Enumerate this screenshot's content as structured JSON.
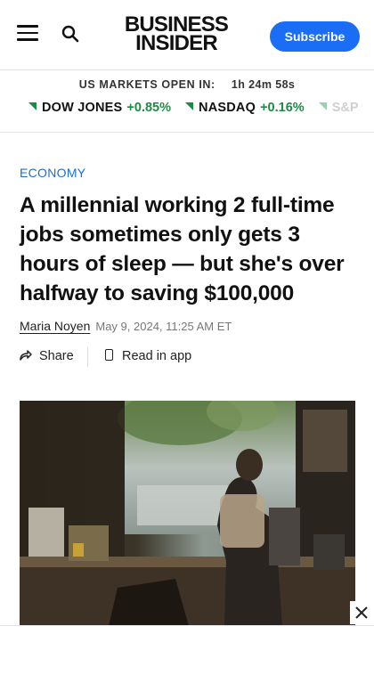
{
  "header": {
    "logo_line1": "BUSINESS",
    "logo_line2": "INSIDER",
    "subscribe_label": "Subscribe"
  },
  "markets": {
    "status_label": "US MARKETS OPEN IN:",
    "countdown": "1h 24m 58s",
    "tickers": [
      {
        "name": "DOW JONES",
        "change": "+0.85%"
      },
      {
        "name": "NASDAQ",
        "change": "+0.16%"
      },
      {
        "name": "S&P",
        "change": ""
      }
    ],
    "up_color": "#1e8a44"
  },
  "article": {
    "category": "ECONOMY",
    "headline": "A millennial working 2 full-time jobs sometimes only gets 3 hours of sleep — but she's over halfway to saving $100,000",
    "author": "Maria Noyen",
    "date": "May 9, 2024, 11:25 AM ET",
    "share_label": "Share",
    "read_in_app_label": "Read in app"
  },
  "icons": {
    "menu": "hamburger-menu-icon",
    "search": "search-icon",
    "share": "share-arrow-icon",
    "read_in_app": "phone-icon",
    "close": "close-icon"
  },
  "colors": {
    "accent": "#1a6ef5",
    "category": "#1b6fd1"
  }
}
